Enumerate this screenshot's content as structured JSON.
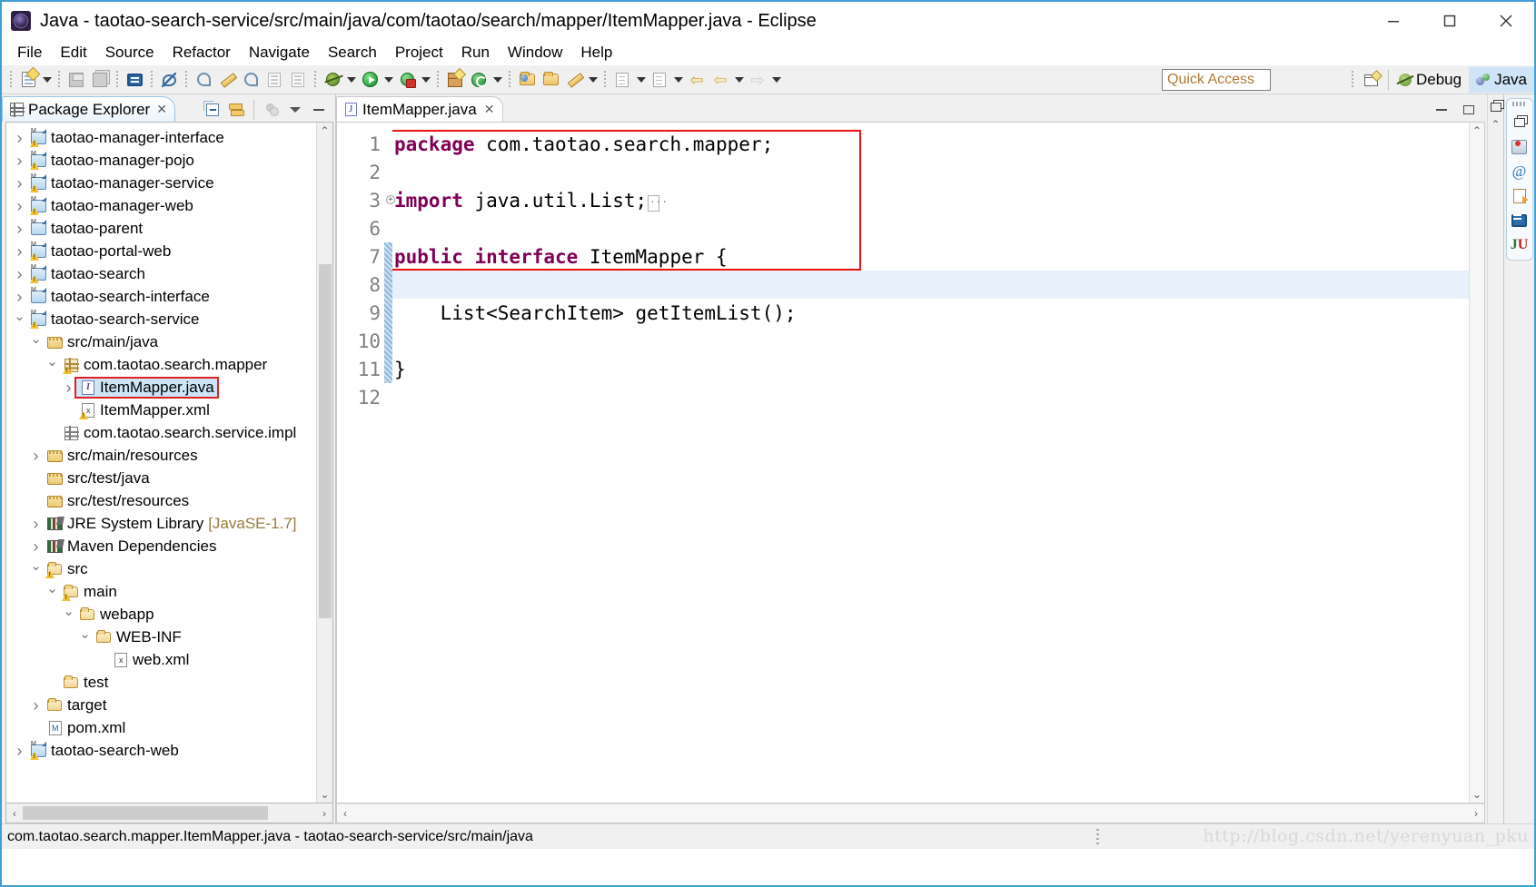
{
  "window": {
    "title": "Java - taotao-search-service/src/main/java/com/taotao/search/mapper/ItemMapper.java - Eclipse",
    "app_icon": "eclipse-icon",
    "minimize_label": "Minimize",
    "maximize_label": "Maximize",
    "close_label": "Close"
  },
  "menubar": {
    "items": [
      {
        "label": "File"
      },
      {
        "label": "Edit"
      },
      {
        "label": "Source"
      },
      {
        "label": "Refactor"
      },
      {
        "label": "Navigate"
      },
      {
        "label": "Search"
      },
      {
        "label": "Project"
      },
      {
        "label": "Run"
      },
      {
        "label": "Window"
      },
      {
        "label": "Help"
      }
    ]
  },
  "toolbar": {
    "buttons": [
      {
        "name": "new-button",
        "icon": "new-document-icon",
        "dropdown": true
      },
      {
        "name": "save-button",
        "icon": "save-icon",
        "dropdown": false
      },
      {
        "name": "save-all-button",
        "icon": "save-all-icon",
        "dropdown": false
      },
      {
        "name": "open-console-button",
        "icon": "console-icon",
        "dropdown": false
      },
      {
        "name": "toggle-annotations-button",
        "icon": "annotation-icon",
        "dropdown": false
      },
      {
        "name": "new-java-class-button",
        "icon": "new-class-icon",
        "dropdown": false
      },
      {
        "name": "source-button",
        "icon": "pen-icon",
        "dropdown": false
      },
      {
        "name": "toggle-mark-occurrences-button",
        "icon": "occurrences-icon",
        "dropdown": false
      },
      {
        "name": "show-whitespace-button",
        "icon": "whitespace-icon",
        "dropdown": false
      },
      {
        "name": "paragraph-marks-button",
        "icon": "paragraph-icon",
        "dropdown": false
      },
      {
        "name": "debug-button",
        "icon": "bug-icon",
        "dropdown": true
      },
      {
        "name": "run-button",
        "icon": "run-icon",
        "dropdown": true
      },
      {
        "name": "run-external-tools-button",
        "icon": "run-lock-icon",
        "dropdown": true
      },
      {
        "name": "new-package-button",
        "icon": "new-package-icon",
        "dropdown": false
      },
      {
        "name": "new-annotation-button",
        "icon": "refresh-green-icon",
        "dropdown": true
      },
      {
        "name": "open-type-button",
        "icon": "open-type-icon",
        "dropdown": false
      },
      {
        "name": "open-task-button",
        "icon": "folder-icon",
        "dropdown": false
      },
      {
        "name": "edit-task-button",
        "icon": "pencil-icon",
        "dropdown": true
      },
      {
        "name": "previous-annotation-button",
        "icon": "previous-annotation-icon",
        "dropdown": true
      },
      {
        "name": "next-annotation-button",
        "icon": "next-annotation-icon",
        "dropdown": true
      },
      {
        "name": "back-button",
        "icon": "arrow-back-yellow-icon",
        "dropdown": false
      },
      {
        "name": "back-history-button",
        "icon": "arrow-back-icon",
        "dropdown": true
      },
      {
        "name": "forward-button",
        "icon": "arrow-forward-icon",
        "dropdown": true
      }
    ],
    "quick_access_placeholder": "Quick Access",
    "open_perspective_label": "Open Perspective",
    "perspectives": [
      {
        "label": "Debug",
        "icon": "debug-perspective-icon",
        "active": false
      },
      {
        "label": "Java",
        "icon": "java-perspective-icon",
        "active": true
      }
    ]
  },
  "package_explorer": {
    "tab_title": "Package Explorer",
    "tab_icon": "package-explorer-icon",
    "close_glyph": "✕",
    "view_toolbar": [
      {
        "name": "collapse-all-button",
        "icon": "collapse-all-icon"
      },
      {
        "name": "link-with-editor-button",
        "icon": "link-editor-icon"
      },
      {
        "name": "focus-on-active-task-button",
        "icon": "focus-task-icon"
      },
      {
        "name": "view-menu-button",
        "icon": "view-menu-icon"
      },
      {
        "name": "minimize-view-button",
        "icon": "minimize-icon"
      },
      {
        "name": "maximize-view-button",
        "icon": "maximize-icon"
      }
    ],
    "tree": [
      {
        "label": "taotao-manager-interface",
        "indent": 0,
        "twisty": "collapsed",
        "icon": "maven-project-warn-icon",
        "selected": false
      },
      {
        "label": "taotao-manager-pojo",
        "indent": 0,
        "twisty": "collapsed",
        "icon": "maven-project-warn-icon",
        "selected": false
      },
      {
        "label": "taotao-manager-service",
        "indent": 0,
        "twisty": "collapsed",
        "icon": "maven-project-warn-icon",
        "selected": false
      },
      {
        "label": "taotao-manager-web",
        "indent": 0,
        "twisty": "collapsed",
        "icon": "maven-project-warn-icon",
        "selected": false
      },
      {
        "label": "taotao-parent",
        "indent": 0,
        "twisty": "collapsed",
        "icon": "maven-project-icon",
        "selected": false
      },
      {
        "label": "taotao-portal-web",
        "indent": 0,
        "twisty": "collapsed",
        "icon": "maven-project-warn-icon",
        "selected": false
      },
      {
        "label": "taotao-search",
        "indent": 0,
        "twisty": "collapsed",
        "icon": "maven-project-warn-icon",
        "selected": false
      },
      {
        "label": "taotao-search-interface",
        "indent": 0,
        "twisty": "collapsed",
        "icon": "maven-project-icon",
        "selected": false
      },
      {
        "label": "taotao-search-service",
        "indent": 0,
        "twisty": "expanded",
        "icon": "maven-project-warn-icon",
        "selected": false
      },
      {
        "label": "src/main/java",
        "indent": 1,
        "twisty": "expanded",
        "icon": "source-folder-icon",
        "selected": false
      },
      {
        "label": "com.taotao.search.mapper",
        "indent": 2,
        "twisty": "expanded",
        "icon": "package-warn-icon",
        "selected": false
      },
      {
        "label": "ItemMapper.java",
        "indent": 3,
        "twisty": "collapsed",
        "icon": "java-interface-file-icon",
        "selected": true,
        "highlight_box": true
      },
      {
        "label": "ItemMapper.xml",
        "indent": 3,
        "twisty": "none",
        "icon": "xml-file-warn-icon",
        "selected": false
      },
      {
        "label": "com.taotao.search.service.impl",
        "indent": 2,
        "twisty": "none",
        "icon": "package-icon",
        "selected": false
      },
      {
        "label": "src/main/resources",
        "indent": 1,
        "twisty": "collapsed",
        "icon": "source-folder-icon",
        "selected": false
      },
      {
        "label": "src/test/java",
        "indent": 1,
        "twisty": "none",
        "icon": "source-folder-icon",
        "selected": false
      },
      {
        "label": "src/test/resources",
        "indent": 1,
        "twisty": "none",
        "icon": "source-folder-icon",
        "selected": false
      },
      {
        "label": "JRE System Library",
        "suffix": "[JavaSE-1.7]",
        "indent": 1,
        "twisty": "collapsed",
        "icon": "library-icon",
        "selected": false
      },
      {
        "label": "Maven Dependencies",
        "indent": 1,
        "twisty": "collapsed",
        "icon": "library-icon",
        "selected": false
      },
      {
        "label": "src",
        "indent": 1,
        "twisty": "expanded",
        "icon": "folder-src-icon",
        "selected": false
      },
      {
        "label": "main",
        "indent": 2,
        "twisty": "expanded",
        "icon": "folder-src-icon",
        "selected": false
      },
      {
        "label": "webapp",
        "indent": 3,
        "twisty": "expanded",
        "icon": "folder-icon",
        "selected": false
      },
      {
        "label": "WEB-INF",
        "indent": 4,
        "twisty": "expanded",
        "icon": "folder-icon",
        "selected": false
      },
      {
        "label": "web.xml",
        "indent": 5,
        "twisty": "none",
        "icon": "xml-file-icon",
        "selected": false
      },
      {
        "label": "test",
        "indent": 2,
        "twisty": "none",
        "icon": "folder-icon",
        "selected": false
      },
      {
        "label": "target",
        "indent": 1,
        "twisty": "collapsed",
        "icon": "folder-icon",
        "selected": false
      },
      {
        "label": "pom.xml",
        "indent": 1,
        "twisty": "none",
        "icon": "pom-file-icon",
        "selected": false
      },
      {
        "label": "taotao-search-web",
        "indent": 0,
        "twisty": "collapsed",
        "icon": "maven-project-warn-icon",
        "selected": false
      }
    ]
  },
  "editor": {
    "tab_title": "ItemMapper.java",
    "tab_icon": "java-file-icon",
    "close_glyph": "✕",
    "minimize_label": "Minimize",
    "maximize_label": "Maximize",
    "lines": [
      {
        "number": "1",
        "fold": false,
        "highlight": false,
        "tokens": [
          {
            "t": "package",
            "c": "kw"
          },
          {
            "t": " com.taotao.search.mapper;",
            "c": "plain"
          }
        ]
      },
      {
        "number": "2",
        "fold": false,
        "highlight": false,
        "tokens": []
      },
      {
        "number": "3",
        "fold": true,
        "highlight": false,
        "tokens": [
          {
            "t": "import",
            "c": "kw"
          },
          {
            "t": " java.util.List;",
            "c": "plain"
          }
        ],
        "folded_marker": true
      },
      {
        "number": "6",
        "fold": false,
        "highlight": false,
        "tokens": []
      },
      {
        "number": "7",
        "fold": false,
        "highlight": false,
        "tokens": [
          {
            "t": "public interface",
            "c": "kw"
          },
          {
            "t": " ItemMapper {",
            "c": "plain"
          }
        ]
      },
      {
        "number": "8",
        "fold": false,
        "highlight": true,
        "tokens": []
      },
      {
        "number": "9",
        "fold": false,
        "highlight": false,
        "tokens": [
          {
            "t": "    List<SearchItem> getItemList();",
            "c": "plain"
          }
        ]
      },
      {
        "number": "10",
        "fold": false,
        "highlight": false,
        "tokens": []
      },
      {
        "number": "11",
        "fold": false,
        "highlight": false,
        "tokens": [
          {
            "t": "}",
            "c": "plain"
          }
        ]
      },
      {
        "number": "12",
        "fold": false,
        "highlight": false,
        "tokens": []
      }
    ]
  },
  "right_bar": {
    "items": [
      {
        "name": "restore-button",
        "icon": "restore-icon"
      },
      {
        "name": "servers-view-button",
        "icon": "servers-icon"
      },
      {
        "name": "annotations-view-button",
        "icon": "at-icon"
      },
      {
        "name": "outline-view-button",
        "icon": "outline-icon"
      },
      {
        "name": "console-view-button",
        "icon": "console-icon"
      },
      {
        "name": "junit-view-button",
        "icon": "junit-icon"
      }
    ]
  },
  "statusbar": {
    "text": "com.taotao.search.mapper.ItemMapper.java - taotao-search-service/src/main/java",
    "watermark": "http://blog.csdn.net/yerenyuan_pku"
  }
}
